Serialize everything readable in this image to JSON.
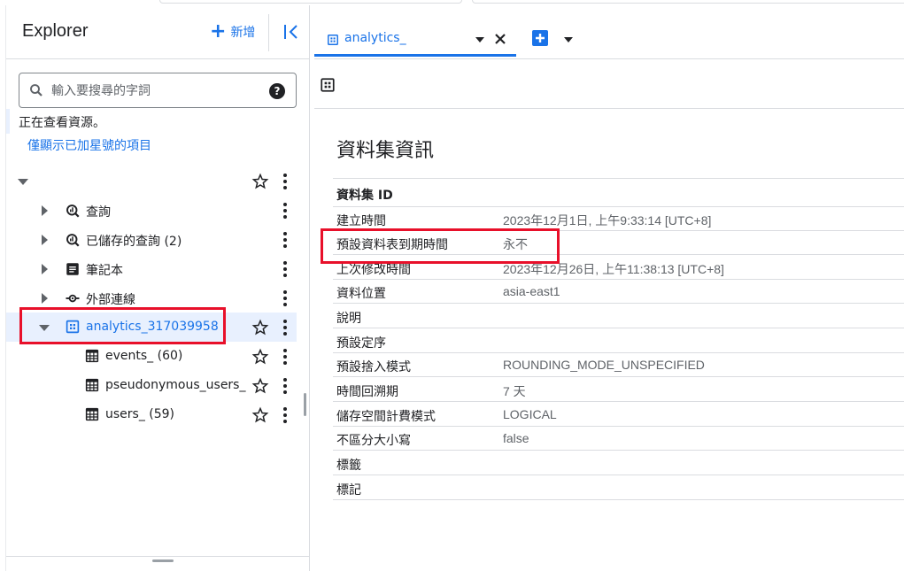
{
  "sidebar": {
    "title": "Explorer",
    "new_label": "新增",
    "search_placeholder": "輸入要搜尋的字詞",
    "viewing_text": "正在查看資源。",
    "starred_link": "僅顯示已加星號的項目",
    "tree": {
      "queries": "查詢",
      "saved_queries": "已儲存的查詢 (2)",
      "notebooks": "筆記本",
      "external_connections": "外部連線",
      "dataset": "analytics_317039958",
      "tables": [
        "events_ (60)",
        "pseudonymous_users_ ...",
        "users_ (59)"
      ]
    }
  },
  "tab": {
    "label": "analytics_"
  },
  "main": {
    "section_title": "資料集資訊",
    "rows": [
      {
        "key": "資料集 ID",
        "value": ""
      },
      {
        "key": "建立時間",
        "value": "2023年12月1日, 上午9:33:14 [UTC+8]"
      },
      {
        "key": "預設資料表到期時間",
        "value": "永不"
      },
      {
        "key": "上次修改時間",
        "value": "2023年12月26日, 上午11:38:13 [UTC+8]"
      },
      {
        "key": "資料位置",
        "value": "asia-east1"
      },
      {
        "key": "說明",
        "value": ""
      },
      {
        "key": "預設定序",
        "value": ""
      },
      {
        "key": "預設捨入模式",
        "value": "ROUNDING_MODE_UNSPECIFIED"
      },
      {
        "key": "時間回溯期",
        "value": "7 天"
      },
      {
        "key": "儲存空間計費模式",
        "value": "LOGICAL"
      },
      {
        "key": "不區分大小寫",
        "value": "false"
      },
      {
        "key": "標籤",
        "value": ""
      },
      {
        "key": "標記",
        "value": ""
      }
    ]
  },
  "colors": {
    "accent": "#1a73e8",
    "highlight": "#e8102a",
    "text": "#202124",
    "muted": "#5f6368"
  },
  "icons": [
    "plus-icon",
    "collapse-panel-icon",
    "search-icon",
    "help-icon",
    "caret-icon",
    "query-icon",
    "saved-query-icon",
    "notebook-icon",
    "connection-icon",
    "dataset-icon",
    "table-icon",
    "star-icon",
    "more-vert-icon",
    "close-icon",
    "add-tab-icon"
  ]
}
